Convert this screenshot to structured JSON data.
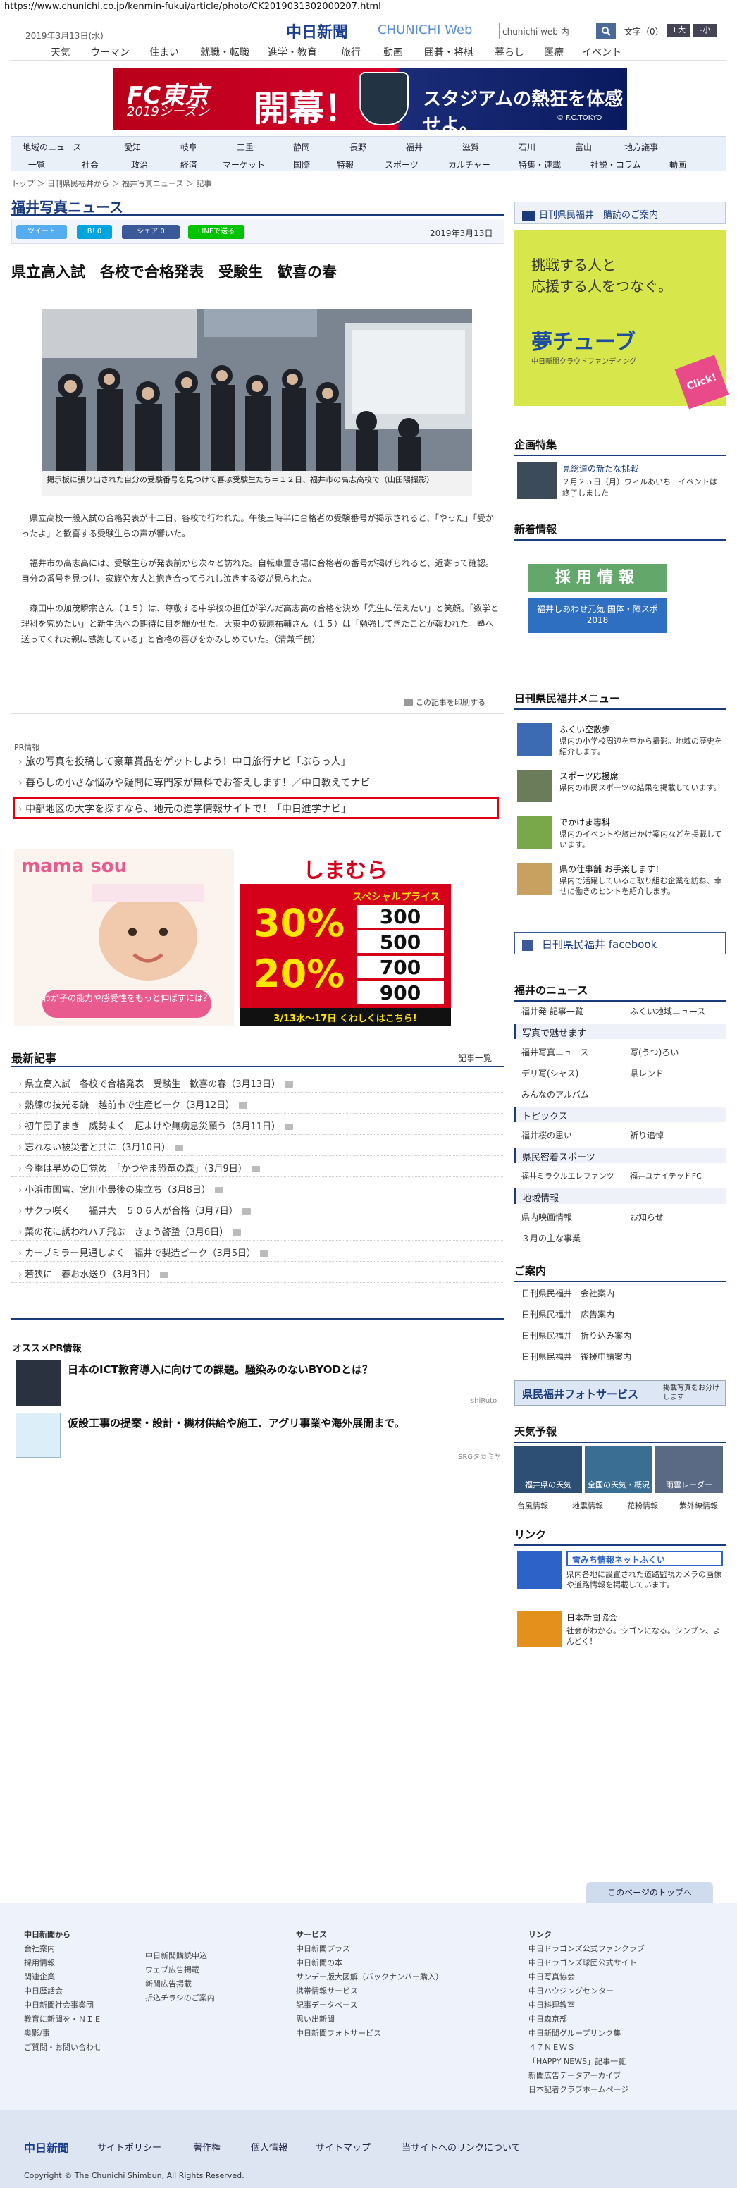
{
  "url": "https://www.chunichi.co.jp/kenmin-fukui/article/photo/CK2019031302000207.html",
  "header": {
    "logo": "中日新聞",
    "logo_web": "CHUNICHI Web",
    "date": "2019年3月13日(水)",
    "search_value": "chunichi web 内",
    "font_size_label": "文字（0）",
    "font_big": "+大",
    "font_small": "-小"
  },
  "topnav": [
    "天気",
    "ウーマン",
    "住まい",
    "就職・転職",
    "進学・教育",
    "旅行",
    "動画",
    "囲碁・将棋",
    "暮らし",
    "医療",
    "イベント"
  ],
  "banner": {
    "text1": "FC東京",
    "text2": "2019シーズン",
    "text3": "開幕！",
    "text4": "スタジアムの熱狂を体感せよ。",
    "text5": "© F.C.TOKYO"
  },
  "catnav": {
    "row1": [
      "地域のニュース",
      "愛知",
      "岐阜",
      "三重",
      "静岡",
      "長野",
      "福井",
      "滋賀",
      "石川",
      "富山",
      "地方議事"
    ],
    "row2": [
      "一覧",
      "社会",
      "政治",
      "経済",
      "マーケット",
      "国際",
      "特報",
      "スポーツ",
      "カルチャー",
      "特集・連載",
      "社説・コラム",
      "動画"
    ]
  },
  "breadcrumb": "トップ ＞ 日刊県民福井から ＞ 福井写真ニュース ＞ 記事",
  "section_title": "福井写真ニュース",
  "social": {
    "tweet": "ツイート",
    "hatena": "B! 0",
    "share": "シェア 0",
    "line": "LINEで送る"
  },
  "article": {
    "date": "2019年3月13日",
    "headline": "県立高入試　各校で合格発表　受験生　歓喜の春",
    "caption": "掲示板に張り出された自分の受験番号を見つけて喜ぶ受験生たち＝１２日、福井市の高志高校で（山田陽撮影）",
    "p1": "　県立高校一般入試の合格発表が十二日、各校で行われた。午後三時半に合格者の受験番号が掲示されると、「やった」「受かったよ」と歓喜する受験生らの声が響いた。",
    "p2": "　福井市の高志高には、受験生らが発表前から次々と訪れた。自転車置き場に合格者の番号が掲げられると、近寄って確認。自分の番号を見つけ、家族や友人と抱き合ってうれし泣きする姿が見られた。",
    "p3": "　森田中の加茂瞬宗さん（１５）は、尊敬する中学校の担任が学んだ高志高の合格を決め「先生に伝えたい」と笑顔。「数学と理科を究めたい」と新生活への期待に目を輝かせた。大東中の荻原祐輔さん（１５）は「勉強してきたことが報われた。塾へ送ってくれた親に感謝している」と合格の喜びをかみしめていた。（清兼千鶴）",
    "print": "この記事を印刷する"
  },
  "pr": {
    "label": "PR情報",
    "items": [
      "旅の写真を投稿して豪華賞品をゲットしよう！中日旅行ナビ「ぶらっ人」",
      "暮らしの小さな悩みや疑問に専門家が無料でお答えします！／中日教えてナビ",
      "中部地区の大学を探すなら、地元の進学情報サイトで！「中日進学ナビ」"
    ]
  },
  "ads": {
    "mama_brand": "mama sou",
    "mama_copy": "わが子の能力や感受性をもっと伸ばすには？",
    "shima_brand": "しまむら",
    "shima_sub": "スペシャルプライス",
    "shima_p1": "30%",
    "shima_p2": "20%",
    "shima_prices": [
      "300",
      "500",
      "700",
      "900"
    ],
    "shima_date": "3/13水〜17日 くわしくはこちら!"
  },
  "latest": {
    "title": "最新記事",
    "more": "記事一覧",
    "items": [
      "県立高入試　各校で合格発表　受験生　歓喜の春（3月13日）",
      "熱練の技光る鎌　越前市で生産ピーク（3月12日）",
      "初午団子まき　威勢よく　厄よけや無病息災願う（3月11日）",
      "忘れない被災者と共に（3月10日）",
      "今季は早めの目覚め　「かつやま恐竜の森」（3月9日）",
      "小浜市国富、宮川小最後の巣立ち（3月8日）",
      "サクラ咲く　　福井大　５０６人が合格（3月7日）",
      "菜の花に誘われハチ飛ぶ　きょう啓蟄（3月6日）",
      "カーブミラー見通しよく　福井で製造ピーク（3月5日）",
      "若狭に　春お水送り（3月3日）"
    ]
  },
  "recommend": {
    "title": "オススメPR情報",
    "items": [
      {
        "text": "日本のICT教育導入に向けての課題。騒染みのないBYODとは？",
        "src": "shiRuto"
      },
      {
        "text": "仮設工事の提案・設計・機材供給や施工、アグリ事業や海外展開まで。",
        "src": "SRGタカミヤ"
      }
    ]
  },
  "sidebar": {
    "subscribe": "日刊県民福井　購読のご案内",
    "yume_copy1": "挑戦する人と",
    "yume_copy2": "応援する人をつなぐ。",
    "yume_brand": "夢チューブ",
    "yume_sub": "中日新聞クラウドファンディング",
    "yume_click": "Click!",
    "feature_title": "企画特集",
    "feature_link": "見総道の新たな挑戦",
    "feature_desc": "２月２５日（月）ウィルあいち　イベントは終了しました",
    "new_title": "新着情報",
    "saiyo": "採用情報",
    "kokutai": "福井しあわせ元気 国体・障スポ 2018",
    "menu_title": "日刊県民福井メニュー",
    "menu": [
      {
        "name": "ふくい空散歩",
        "desc": "県内の小学校周辺を空から撮影。地域の歴史を紹介します。"
      },
      {
        "name": "スポーツ応援席",
        "desc": "県内の市民スポーツの結果を掲載しています。"
      },
      {
        "name": "でかけま専科",
        "desc": "県内のイベントや旅出かけ案内などを掲載しています。"
      },
      {
        "name": "県の仕事舗 お手楽します！",
        "desc": "県内で活躍しているこ取り組む企業を訪ね、幸せに働きのヒントを紹介します。"
      }
    ],
    "facebook": "日刊県民福井 facebook",
    "news_title": "福井のニュース",
    "news_links": [
      [
        "福井発 記事一覧",
        "ふくい地域ニュース"
      ]
    ],
    "photo_sub": "写真で魅せます",
    "photo_links": [
      [
        "福井写真ニュース",
        "写(うつ)ろい"
      ],
      [
        "デリ写(シャス)",
        "県レンド"
      ],
      [
        "みんなのアルバム",
        ""
      ]
    ],
    "topics_sub": "トピックス",
    "topics_links": [
      [
        "福井桜の思い",
        "祈り追悼"
      ]
    ],
    "sports_sub": "県民密着スポーツ",
    "sports_links": [
      [
        "福井ミラクルエレファンツ",
        "福井ユナイテッドFC"
      ]
    ],
    "region_sub": "地域情報",
    "region_links": [
      [
        "県内映画情報",
        "お知らせ"
      ],
      [
        "３月の主な事業",
        ""
      ]
    ],
    "guide_title": "ご案内",
    "guide_links": [
      "日刊県民福井　会社案内",
      "日刊県民福井　広告案内",
      "日刊県民福井　折り込み案内",
      "日刊県民福井　後援申請案内"
    ],
    "photo_service": "県民福井フォトサービス",
    "photo_service_desc": "掲載写真をお分けします",
    "weather_title": "天気予報",
    "weather_tiles": [
      "福井県の天気",
      "全国の天気・概況",
      "雨雲レーダー"
    ],
    "weather_links": [
      "台風情報",
      "地震情報",
      "花粉情報",
      "紫外線情報"
    ],
    "link_title": "リンク",
    "link1_name": "雪みち情報ネットふくい",
    "link1_desc": "県内各地に設置された道路監視カメラの画像や道路情報を掲載しています。",
    "link2_name": "日本新聞協会",
    "link2_desc": "社会がわかる。シゴンになる。シンブン、よんどく！"
  },
  "totop": "このページのトップへ",
  "footer": {
    "col1_h": "中日新聞から",
    "col1": [
      "会社案内",
      "採用情報",
      "関連企業",
      "中日歴話会",
      "中日新聞社会事業団",
      "教育に新聞を・ＮＩＥ",
      "奥影/事",
      "ご質問・お問い合わせ"
    ],
    "col2": [
      "中日新聞購読申込",
      "ウェブ広告掲載",
      "新聞広告掲載",
      "折込チラシのご案内"
    ],
    "col3_h": "サービス",
    "col3": [
      "中日新聞プラス",
      "中日新聞の本",
      "サンデー版大図解（バックナンバー購入）",
      "携帯情報サービス",
      "記事データベース",
      "思い出新聞",
      "中日新聞フォトサービス"
    ],
    "col4_h": "リンク",
    "col4": [
      "中日ドラゴンズ公式ファンクラブ",
      "中日ドラゴンズ球団公式サイト",
      "中日写真協会",
      "中日ハウジングセンター",
      "中日料理教室",
      "中日森京部",
      "中日新聞グループリンク集",
      "４７ＮＥＷＳ",
      "「HAPPY NEWS」記事一覧",
      "新聞広告データアーカイブ",
      "日本記者クラブホームページ"
    ]
  },
  "bottom": {
    "logo": "中日新聞",
    "links": [
      "サイトポリシー",
      "著作権",
      "個人情報",
      "サイトマップ",
      "当サイトへのリンクについて"
    ],
    "copyright": "Copyright © The Chunichi Shimbun, All Rights Reserved."
  },
  "colors": {
    "brand": "#1a3c7c",
    "highlight_box": "#e00010",
    "tweet": "#55acee",
    "hatena": "#00a4de",
    "facebook_share": "#3b5998",
    "line": "#00c300"
  }
}
